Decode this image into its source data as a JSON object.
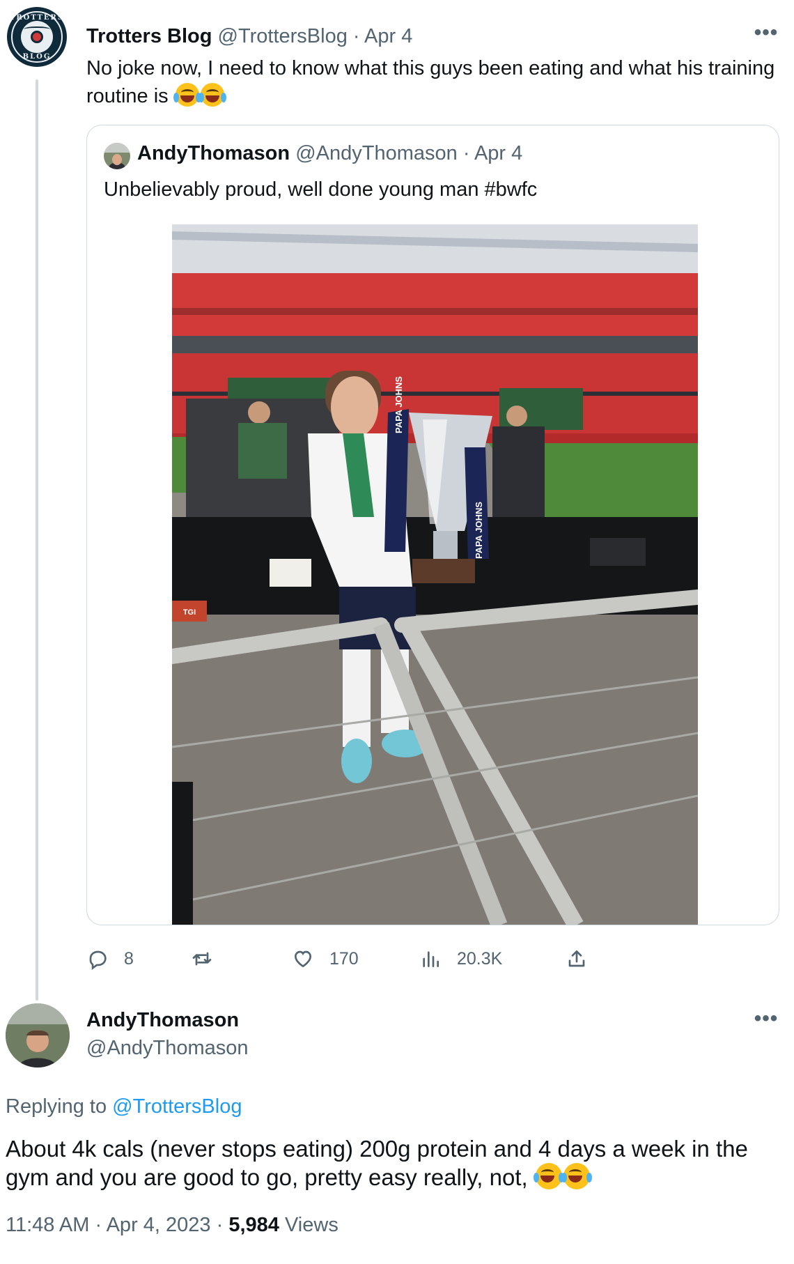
{
  "tweet": {
    "author_name": "Trotters Blog",
    "author_handle": "@TrottersBlog",
    "separator": "·",
    "date": "Apr 4",
    "avatar_text_top": "TROTTERS",
    "avatar_text_bottom": "BLOG",
    "text": "No joke now, I need to know what this guys been eating and what his training routine is",
    "emoji": "face-with-tears-of-joy-icon",
    "more_label": "•••"
  },
  "quoted": {
    "author_name": "AndyThomason",
    "author_handle": "@AndyThomason",
    "separator": "·",
    "date": "Apr 4",
    "text": "Unbelievably proud, well done young man #bwfc",
    "photo": {
      "sponsor_text": "PAPA JOHNS",
      "sign_text": "TGI"
    }
  },
  "actions": {
    "replies": "8",
    "retweets": "",
    "likes": "170",
    "views": "20.3K"
  },
  "reply": {
    "author_name": "AndyThomason",
    "author_handle": "@AndyThomason",
    "more_label": "•••",
    "replying_prefix": "Replying to",
    "replying_to": "@TrottersBlog",
    "text": "About 4k cals (never stops eating) 200g protein and 4 days a week in the gym and you are good to go, pretty easy really, not,",
    "time": "11:48 AM",
    "separator": "·",
    "date": "Apr 4, 2023",
    "views_count": "5,984",
    "views_label": "Views"
  },
  "colors": {
    "text_primary": "#0f1419",
    "text_secondary": "#536471",
    "link": "#1d9bf0",
    "border": "#cfd9de"
  }
}
